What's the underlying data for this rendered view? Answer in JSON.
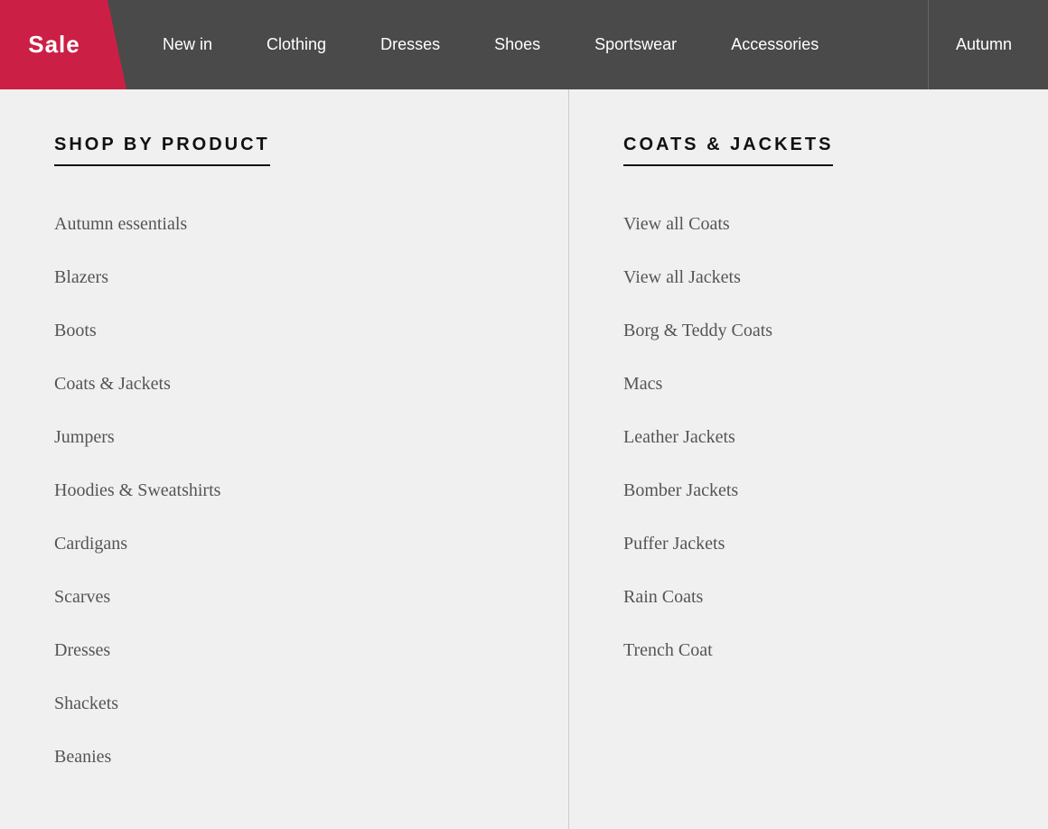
{
  "navbar": {
    "sale_label": "Sale",
    "items": [
      {
        "id": "new-in",
        "label": "New in"
      },
      {
        "id": "clothing",
        "label": "Clothing"
      },
      {
        "id": "dresses",
        "label": "Dresses"
      },
      {
        "id": "shoes",
        "label": "Shoes"
      },
      {
        "id": "sportswear",
        "label": "Sportswear"
      },
      {
        "id": "accessories",
        "label": "Accessories"
      },
      {
        "id": "autumn",
        "label": "Autumn"
      }
    ]
  },
  "left_panel": {
    "title": "SHOP BY PRODUCT",
    "items": [
      "Autumn essentials",
      "Blazers",
      "Boots",
      "Coats & Jackets",
      "Jumpers",
      "Hoodies & Sweatshirts",
      "Cardigans",
      "Scarves",
      "Dresses",
      "Shackets",
      "Beanies"
    ]
  },
  "right_panel": {
    "title": "COATS & JACKETS",
    "items": [
      "View all Coats",
      "View all Jackets",
      "Borg & Teddy Coats",
      "Macs",
      "Leather Jackets",
      "Bomber Jackets",
      "Puffer Jackets",
      "Rain Coats",
      "Trench Coat"
    ]
  }
}
